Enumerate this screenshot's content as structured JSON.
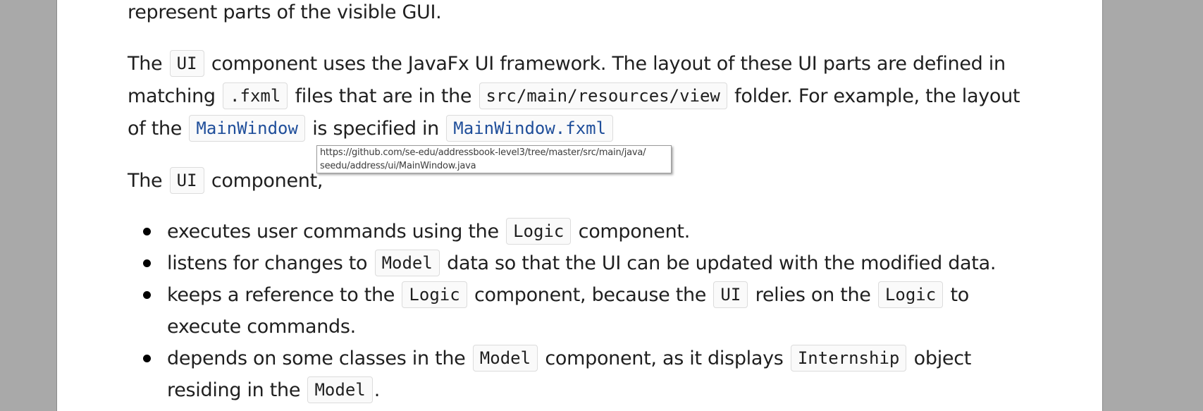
{
  "para_intro_tail": "represent parts of the visible GUI.",
  "para_ui": {
    "t1": "The",
    "c1": "UI",
    "t2": "component uses the JavaFx UI framework. The layout of these UI parts are defined in",
    "t3": "matching",
    "c2": ".fxml",
    "t4": "files that are in the",
    "c3": "src/main/resources/view",
    "t5": "folder. For example, the layout",
    "t6": "of the",
    "link1": "MainWindow",
    "t7": "is specified in",
    "link2": "MainWindow.fxml"
  },
  "tooltip": {
    "line1": "https://github.com/se-edu/addressbook-level3/tree/master/src/main/java/",
    "line2": "seedu/address/ui/MainWindow.java"
  },
  "para_component": {
    "t1": "The",
    "c1": "UI",
    "t2": "component,"
  },
  "bullets": [
    {
      "a": "executes user commands using the",
      "c1": "Logic",
      "b": "component."
    },
    {
      "a": "listens for changes to",
      "c1": "Model",
      "b": "data so that the UI can be updated with the modified data."
    },
    {
      "a": "keeps a reference to the",
      "c1": "Logic",
      "b": "component, because the",
      "c2": "UI",
      "c": "relies on the",
      "c3": "Logic",
      "d": "to",
      "e": "execute commands."
    },
    {
      "a": "depends on some classes in the",
      "c1": "Model",
      "b": "component, as it displays",
      "c2": "Internship",
      "c": "object",
      "d": "residing in the",
      "c3": "Model",
      "e": "."
    }
  ]
}
